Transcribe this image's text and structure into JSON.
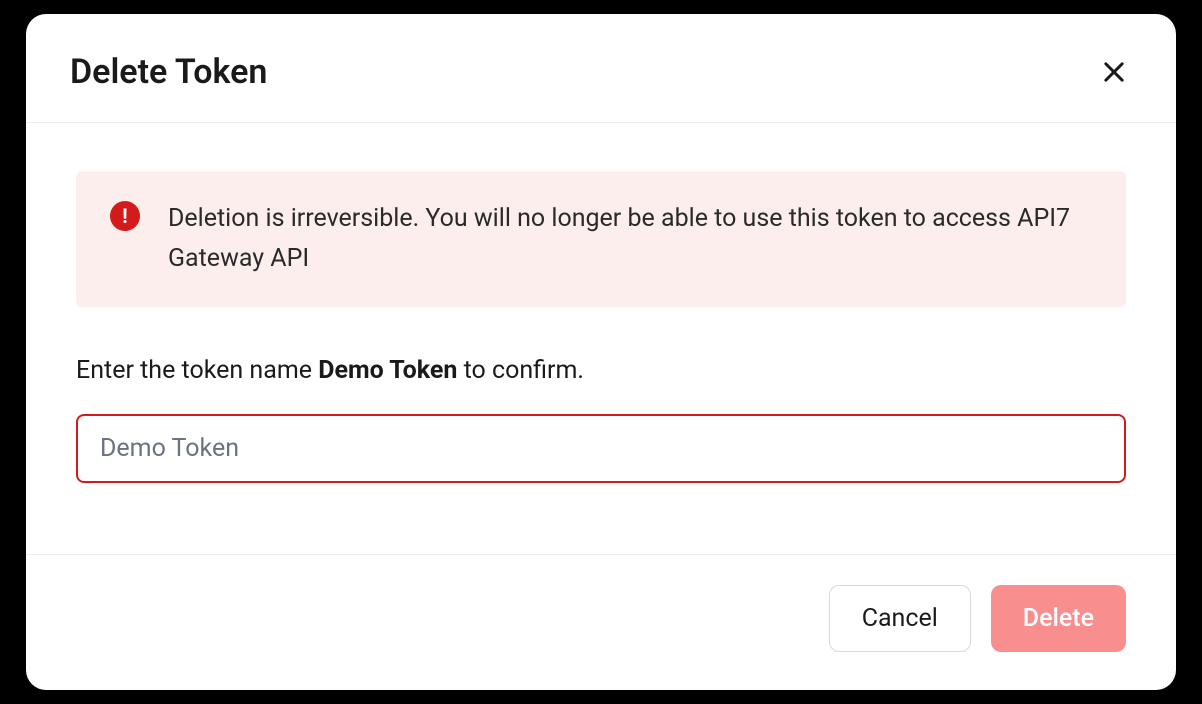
{
  "modal": {
    "title": "Delete Token",
    "alert": {
      "message": "Deletion is irreversible. You will no longer be able to use this token to access API7 Gateway API"
    },
    "confirm": {
      "prefix": "Enter the token name ",
      "token_name": "Demo Token",
      "suffix": " to confirm."
    },
    "input": {
      "placeholder": "Demo Token",
      "value": ""
    },
    "buttons": {
      "cancel": "Cancel",
      "delete": "Delete"
    }
  }
}
